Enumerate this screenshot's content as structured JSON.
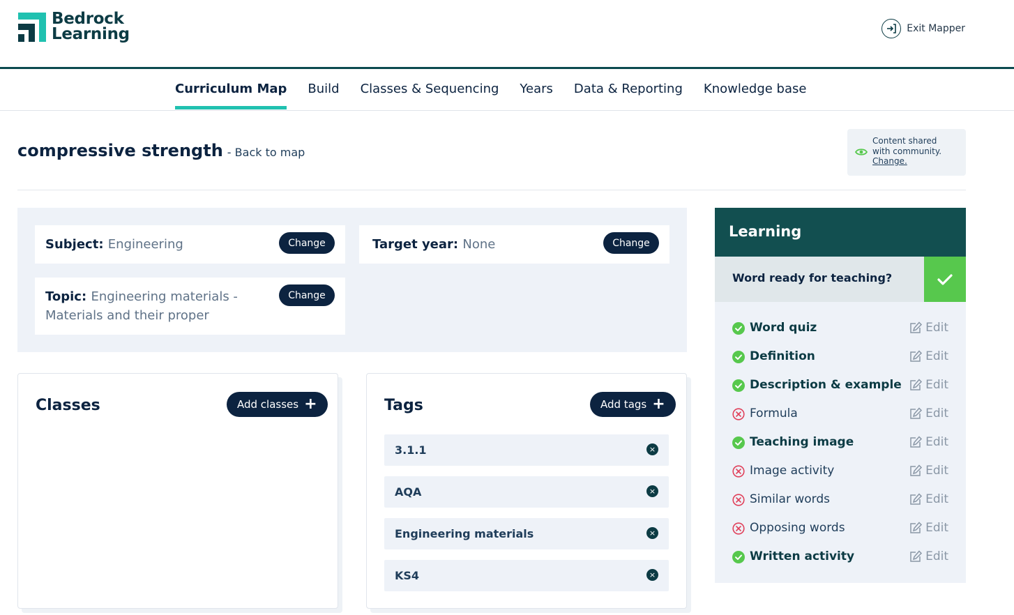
{
  "header": {
    "logo_line1": "Bedrock",
    "logo_line2": "Learning",
    "exit_label": "Exit Mapper"
  },
  "nav": {
    "items": [
      {
        "label": "Curriculum Map",
        "active": true
      },
      {
        "label": "Build",
        "active": false
      },
      {
        "label": "Classes & Sequencing",
        "active": false
      },
      {
        "label": "Years",
        "active": false
      },
      {
        "label": "Data & Reporting",
        "active": false
      },
      {
        "label": "Knowledge base",
        "active": false
      }
    ]
  },
  "page": {
    "word": "compressive strength",
    "back_link": "- Back to map",
    "share": {
      "line1": "Content shared",
      "line2": "with community.",
      "link": "Change."
    }
  },
  "meta": {
    "subject_key": "Subject:",
    "subject_value": "Engineering",
    "target_key": "Target year:",
    "target_value": "None",
    "topic_key": "Topic:",
    "topic_value_line1": "Engineering materials -",
    "topic_value_line2": "Materials and their proper",
    "change_label": "Change"
  },
  "classes": {
    "title": "Classes",
    "add_label": "Add classes",
    "add_icon": "+"
  },
  "tags": {
    "title": "Tags",
    "add_label": "Add tags",
    "add_icon": "+",
    "remove_icon": "×",
    "items": [
      "3.1.1",
      "AQA",
      "Engineering materials",
      "KS4"
    ]
  },
  "learning": {
    "title": "Learning",
    "ready_label": "Word ready for teaching?",
    "edit_label": "Edit",
    "activities": [
      {
        "label": "Word quiz",
        "status": "complete"
      },
      {
        "label": "Definition",
        "status": "complete"
      },
      {
        "label": "Description & example",
        "status": "complete"
      },
      {
        "label": "Formula",
        "status": "incomplete"
      },
      {
        "label": "Teaching image",
        "status": "complete"
      },
      {
        "label": "Image activity",
        "status": "incomplete"
      },
      {
        "label": "Similar words",
        "status": "incomplete"
      },
      {
        "label": "Opposing words",
        "status": "incomplete"
      },
      {
        "label": "Written activity",
        "status": "complete"
      }
    ]
  },
  "colors": {
    "brand_dark": "#0c2340",
    "brand_teal": "#124f50",
    "accent_underline": "#20c1b0",
    "complete_green": "#57c84d",
    "incomplete_red": "#e0405a",
    "panel_bg": "#eef2f8"
  }
}
